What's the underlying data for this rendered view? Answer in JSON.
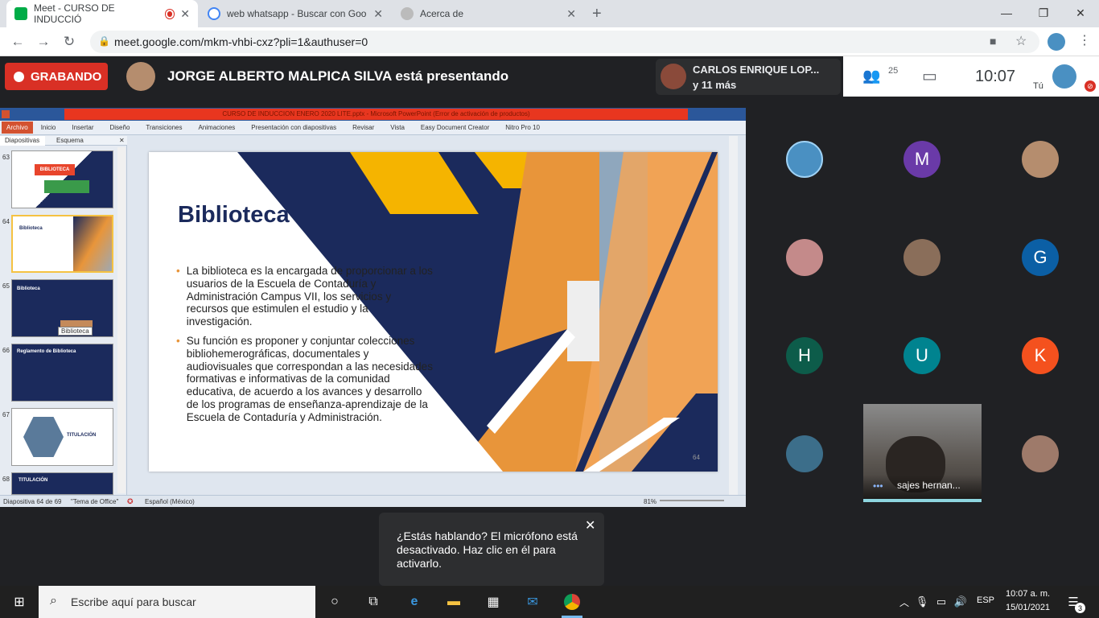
{
  "tabs": [
    {
      "title": "Meet - CURSO DE INDUCCIÓ",
      "favicon": "meet-icon",
      "recording": true
    },
    {
      "title": "web whatsapp - Buscar con Goo",
      "favicon": "google-icon"
    },
    {
      "title": "Acerca de",
      "favicon": "settings-icon"
    }
  ],
  "url": "meet.google.com/mkm-vhbi-cxz?pli=1&authuser=0",
  "meet": {
    "recording_label": "GRABANDO",
    "presenter_text": "JORGE ALBERTO MALPICA SILVA está presentando",
    "caller_name": "CARLOS ENRIQUE LOP...",
    "caller_more": "y 11 más",
    "participants_count": "25",
    "clock": "10:07",
    "self_label": "Tú"
  },
  "ppt": {
    "title_bar": "CURSO DE INDUCCION ENERO 2020 LITE.pptx - Microsoft PowerPoint (Error de activación de productos)",
    "ribbon_tabs": [
      "Archivo",
      "Inicio",
      "Insertar",
      "Diseño",
      "Transiciones",
      "Animaciones",
      "Presentación con diapositivas",
      "Revisar",
      "Vista",
      "Easy Document Creator",
      "Nitro Pro 10"
    ],
    "panel_tabs": [
      "Diapositivas",
      "Esquema"
    ],
    "thumbnails": [
      {
        "num": "63",
        "title": "BIBLIOTECA"
      },
      {
        "num": "64",
        "title": "Biblioteca"
      },
      {
        "num": "65",
        "title": "Biblioteca"
      },
      {
        "num": "66",
        "title": "Reglamento de Biblioteca"
      },
      {
        "num": "67",
        "title": "TITULACIÓN"
      },
      {
        "num": "68",
        "title": "TITULACIÓN"
      }
    ],
    "tooltip": "Biblioteca",
    "slide": {
      "title": "Biblioteca",
      "bullets": [
        "La biblioteca es la encargada de proporcionar a los usuarios de la  Escuela de Contaduría y Administración Campus VII, los servicios y recursos que estimulen el estudio y la investigación.",
        "Su función es proponer y conjuntar colecciones bibliohemerográficas, documentales y audiovisuales que correspondan a las necesidades formativas e informativas de la comunidad educativa, de acuerdo a los avances y desarrollo de los programas de enseñanza-aprendizaje de la Escuela de Contaduría y Administración."
      ],
      "page_number": "64"
    },
    "status": {
      "slide_info": "Diapositiva 64 de 69",
      "theme": "\"Tema de Office\"",
      "language": "Español (México)",
      "zoom": "81%"
    }
  },
  "participants": [
    {
      "initial": "",
      "color": "#4a90c2",
      "type": "image"
    },
    {
      "initial": "M",
      "color": "#6a3aa8"
    },
    {
      "initial": "",
      "color": "#b58d6e",
      "type": "image"
    },
    {
      "initial": "",
      "color": "#c48a8a",
      "type": "image"
    },
    {
      "initial": "",
      "color": "#8a6e5a",
      "type": "image"
    },
    {
      "initial": "G",
      "color": "#0b5fa5"
    },
    {
      "initial": "H",
      "color": "#0d5c4a"
    },
    {
      "initial": "U",
      "color": "#00838f"
    },
    {
      "initial": "K",
      "color": "#f4511e"
    },
    {
      "initial": "",
      "color": "#3c6e8a",
      "type": "image"
    },
    {
      "initial": "",
      "color": "#9e7a6a",
      "type": "image"
    }
  ],
  "video_tile_name": "sajes hernan...",
  "toast": {
    "message": "¿Estás hablando? El micrófono está desactivado. Haz clic en él para activarlo."
  },
  "taskbar": {
    "search_placeholder": "Escribe aquí para buscar",
    "lang": "ESP",
    "time": "10:07 a. m.",
    "date": "15/01/2021",
    "notifications": "3"
  }
}
